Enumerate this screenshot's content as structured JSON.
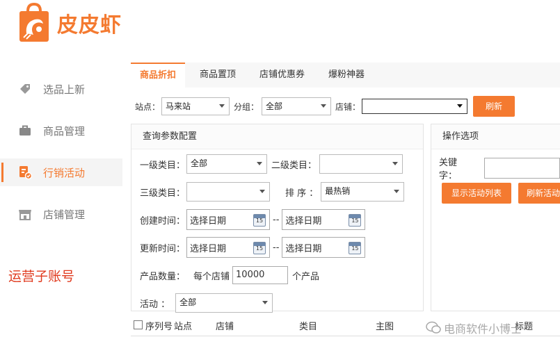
{
  "brand": {
    "name": "皮皮虾",
    "color": "#f47a30"
  },
  "sidebar": {
    "items": [
      {
        "label": "选品上新",
        "icon": "tag-icon"
      },
      {
        "label": "商品管理",
        "icon": "briefcase-icon"
      },
      {
        "label": "行销活动",
        "icon": "campaign-icon",
        "active": true
      },
      {
        "label": "店铺管理",
        "icon": "store-icon"
      }
    ]
  },
  "note": "运营子账号",
  "tabs": [
    {
      "label": "商品折扣",
      "active": true
    },
    {
      "label": "商品置顶"
    },
    {
      "label": "店铺优惠券"
    },
    {
      "label": "爆粉神器"
    }
  ],
  "filters": {
    "site_label": "站点：",
    "site_value": "马来站",
    "group_label": "分组：",
    "group_value": "全部",
    "shop_label": "店铺：",
    "shop_value": "",
    "refresh_label": "刷新"
  },
  "query_panel": {
    "title": "查询参数配置",
    "cat1_label": "一级类目：",
    "cat1_value": "全部",
    "cat2_label": "二级类目：",
    "cat2_value": "",
    "cat3_label": "三级类目：",
    "cat3_value": "",
    "sort_label": "排 序 ：",
    "sort_value": "最热销",
    "created_label": "创建时间：",
    "updated_label": "更新时间：",
    "date_placeholder": "选择日期",
    "date_sep": "--",
    "cal_day": "15",
    "qty_label": "产品数量：",
    "qty_prefix": "每个店铺",
    "qty_value": "10000",
    "qty_suffix": "个产品",
    "activity_label": "活动 ：",
    "activity_value": "全部"
  },
  "ops_panel": {
    "title": "操作选项",
    "keyword_label": "关键字：",
    "keyword_value": "",
    "show_list_btn": "显示活动列表",
    "refresh_activity_btn": "刷新活动"
  },
  "table": {
    "columns": [
      "序列号",
      "站点",
      "店铺",
      "类目",
      "主图",
      "标题"
    ]
  },
  "watermark": "电商软件小博士"
}
